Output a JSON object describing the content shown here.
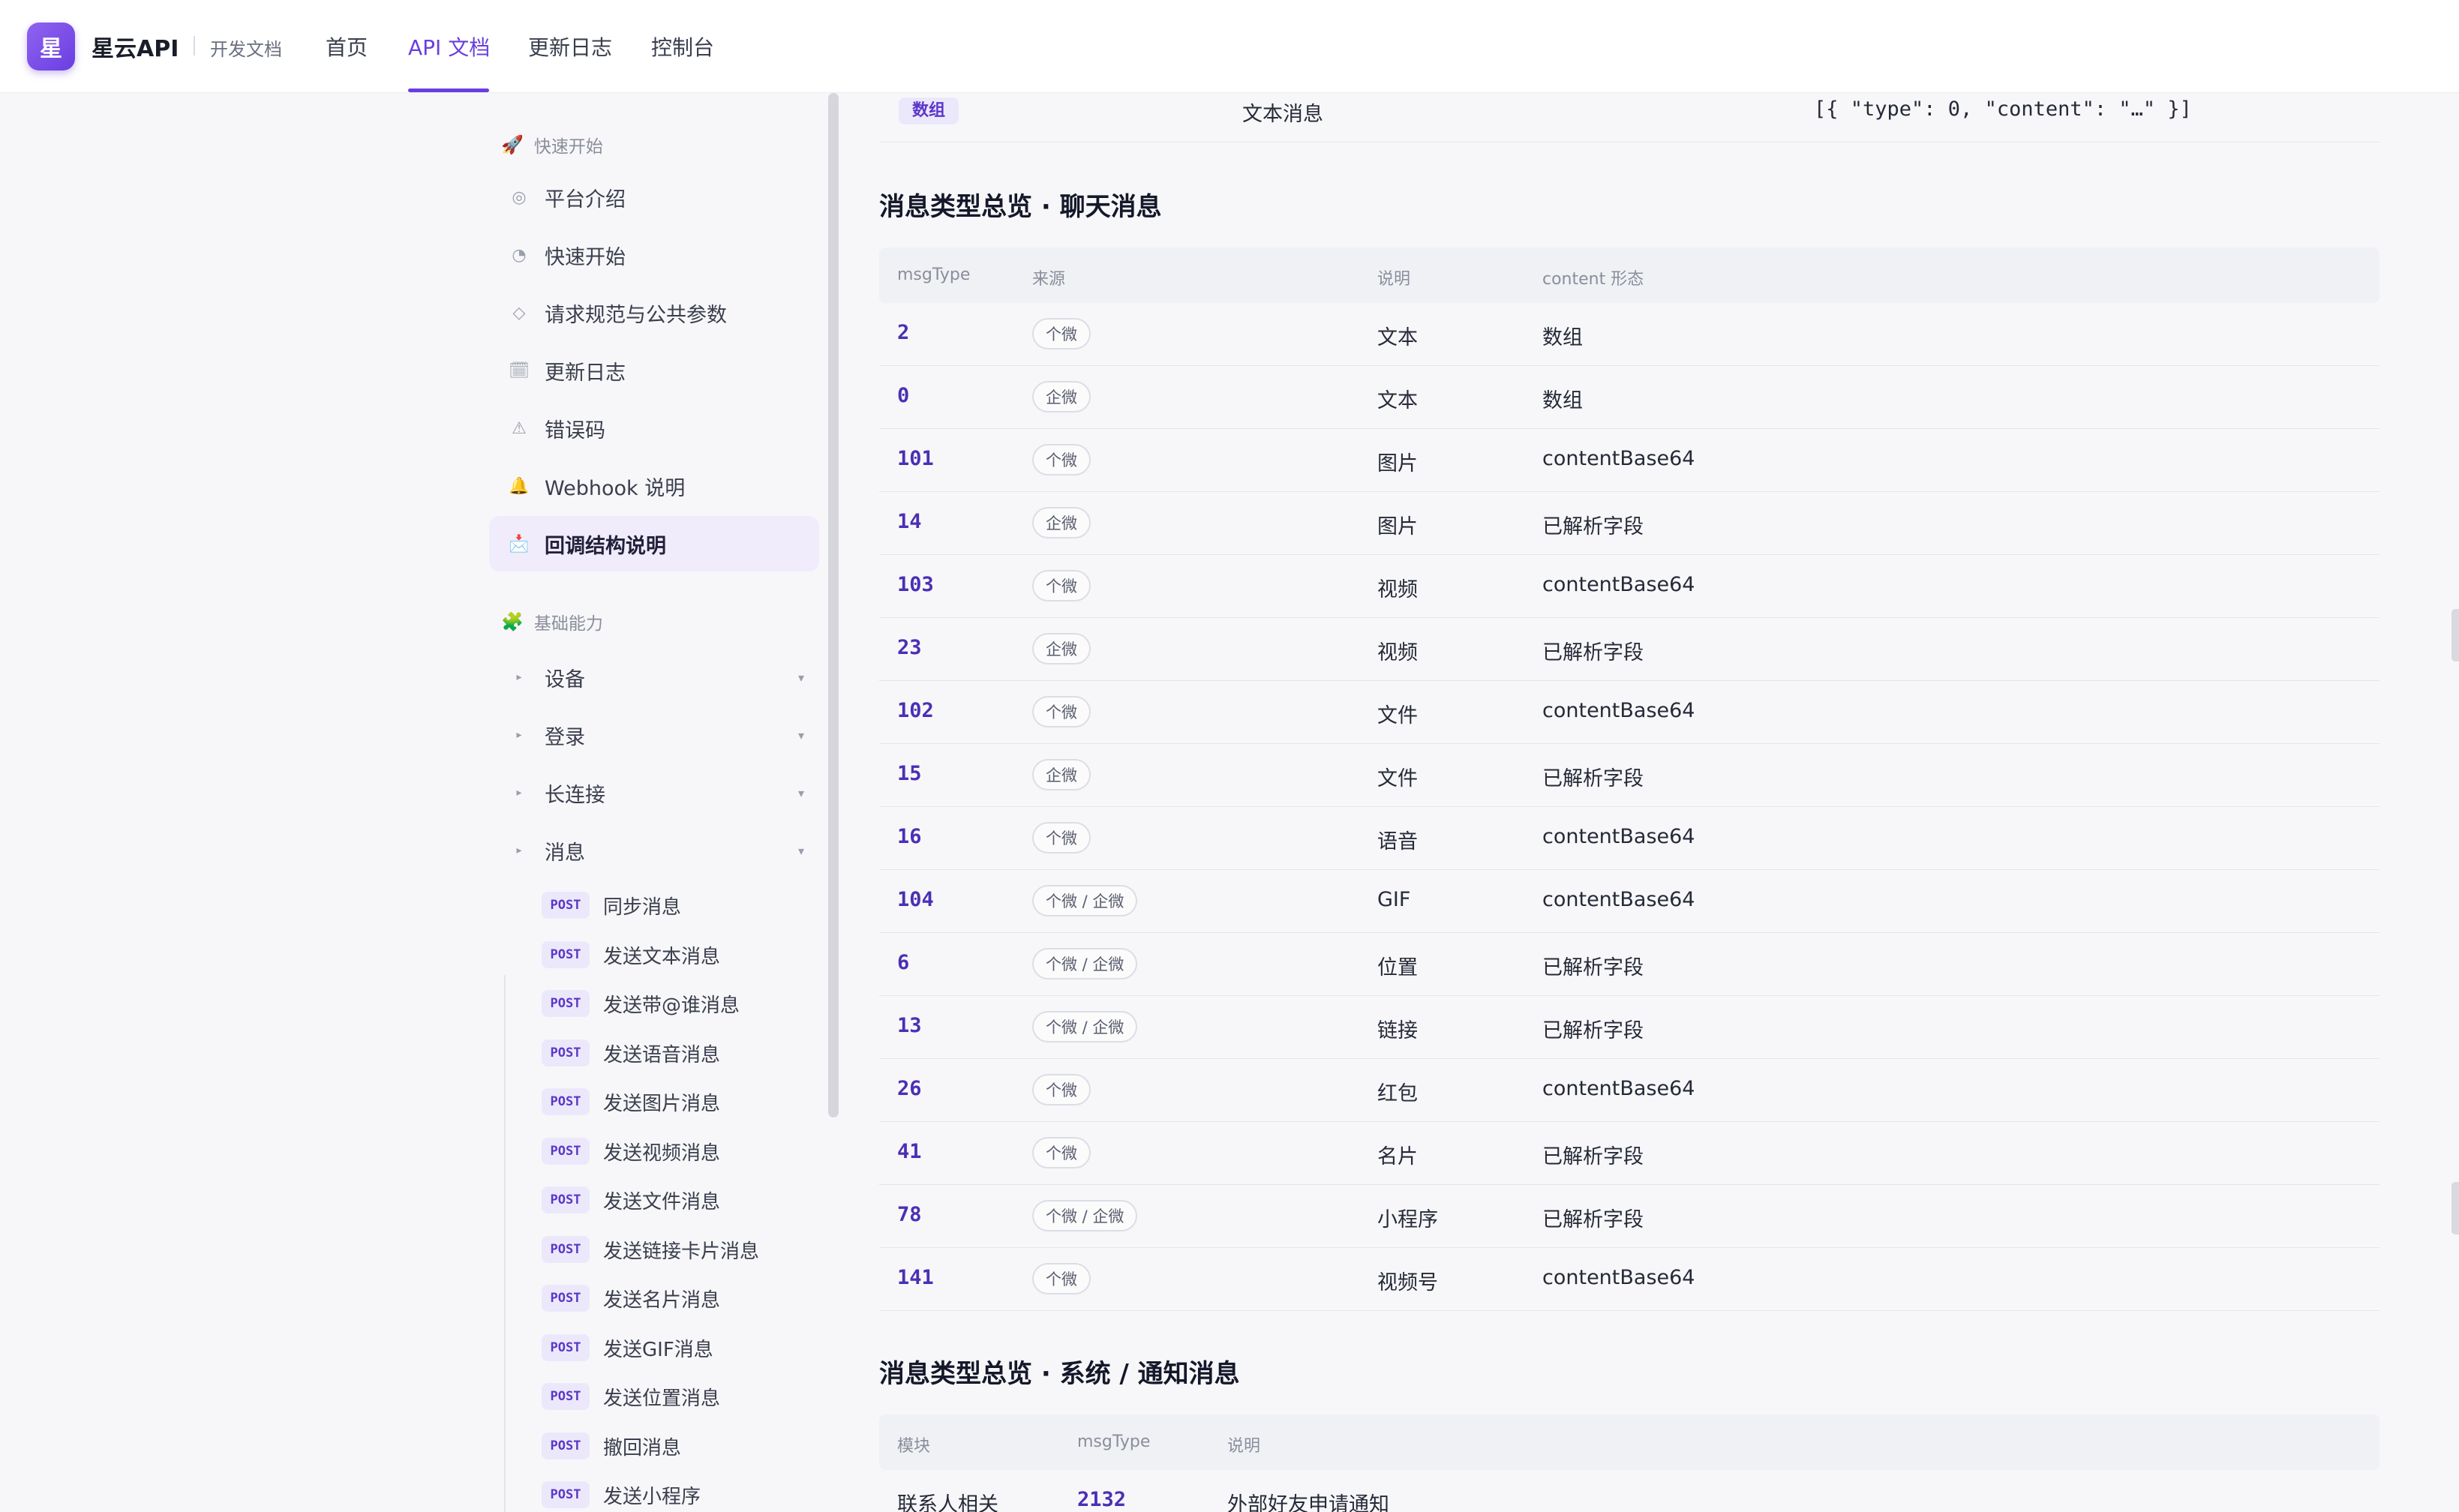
{
  "header": {
    "logo_char": "星",
    "brand": "星云API",
    "subtitle": "开发文档",
    "nav": [
      "首页",
      "API 文档",
      "更新日志",
      "控制台"
    ],
    "active_nav": "API 文档"
  },
  "sidebar": {
    "group1": {
      "icon": "🚀",
      "title": "快速开始"
    },
    "items1": [
      {
        "icon": "◎",
        "label": "平台介绍"
      },
      {
        "icon": "◔",
        "label": "快速开始"
      },
      {
        "icon": "◇",
        "label": "请求规范与公共参数"
      },
      {
        "icon": "🗓",
        "label": "更新日志"
      },
      {
        "icon": "⚠",
        "label": "错误码"
      },
      {
        "icon": "🔔",
        "label": "Webhook 说明"
      },
      {
        "icon": "📩",
        "label": "回调结构说明",
        "active": true
      }
    ],
    "group2": {
      "icon": "🧩",
      "title": "基础能力"
    },
    "items2": [
      {
        "label": "设备"
      },
      {
        "label": "登录"
      },
      {
        "label": "长连接"
      },
      {
        "label": "消息"
      }
    ],
    "method": "POST",
    "sub_items": [
      "同步消息",
      "发送文本消息",
      "发送带@谁消息",
      "发送语音消息",
      "发送图片消息",
      "发送视频消息",
      "发送文件消息",
      "发送链接卡片消息",
      "发送名片消息",
      "发送GIF消息",
      "发送位置消息",
      "撤回消息",
      "发送小程序"
    ]
  },
  "main": {
    "prev_row": {
      "tag": "数组",
      "desc": "文本消息",
      "code": "[{ \"type\": 0, \"content\": \"…\" }]"
    },
    "chat_section": {
      "title": "消息类型总览 · 聊天消息",
      "headers": [
        "msgType",
        "来源",
        "说明",
        "content 形态"
      ],
      "rows": [
        {
          "type": "2",
          "source": "个微",
          "desc": "文本",
          "content": "数组"
        },
        {
          "type": "0",
          "source": "企微",
          "desc": "文本",
          "content": "数组"
        },
        {
          "type": "101",
          "source": "个微",
          "desc": "图片",
          "content": "contentBase64"
        },
        {
          "type": "14",
          "source": "企微",
          "desc": "图片",
          "content": "已解析字段"
        },
        {
          "type": "103",
          "source": "个微",
          "desc": "视频",
          "content": "contentBase64"
        },
        {
          "type": "23",
          "source": "企微",
          "desc": "视频",
          "content": "已解析字段"
        },
        {
          "type": "102",
          "source": "个微",
          "desc": "文件",
          "content": "contentBase64"
        },
        {
          "type": "15",
          "source": "企微",
          "desc": "文件",
          "content": "已解析字段"
        },
        {
          "type": "16",
          "source": "个微",
          "desc": "语音",
          "content": "contentBase64"
        },
        {
          "type": "104",
          "source": "个微 / 企微",
          "desc": "GIF",
          "content": "contentBase64"
        },
        {
          "type": "6",
          "source": "个微 / 企微",
          "desc": "位置",
          "content": "已解析字段"
        },
        {
          "type": "13",
          "source": "个微 / 企微",
          "desc": "链接",
          "content": "已解析字段"
        },
        {
          "type": "26",
          "source": "个微",
          "desc": "红包",
          "content": "contentBase64"
        },
        {
          "type": "41",
          "source": "个微",
          "desc": "名片",
          "content": "已解析字段"
        },
        {
          "type": "78",
          "source": "个微 / 企微",
          "desc": "小程序",
          "content": "已解析字段"
        },
        {
          "type": "141",
          "source": "个微",
          "desc": "视频号",
          "content": "contentBase64"
        }
      ]
    },
    "system_section": {
      "title": "消息类型总览 · 系统 / 通知消息",
      "headers": [
        "模块",
        "msgType",
        "说明"
      ],
      "rows": [
        {
          "module": "联系人相关",
          "type": "2132",
          "desc": "外部好友申请通知"
        }
      ]
    }
  },
  "colors": {
    "accent": "#6a3ee0",
    "badge_bg": "#ece8fb",
    "badge_text": "#5b36c9"
  }
}
